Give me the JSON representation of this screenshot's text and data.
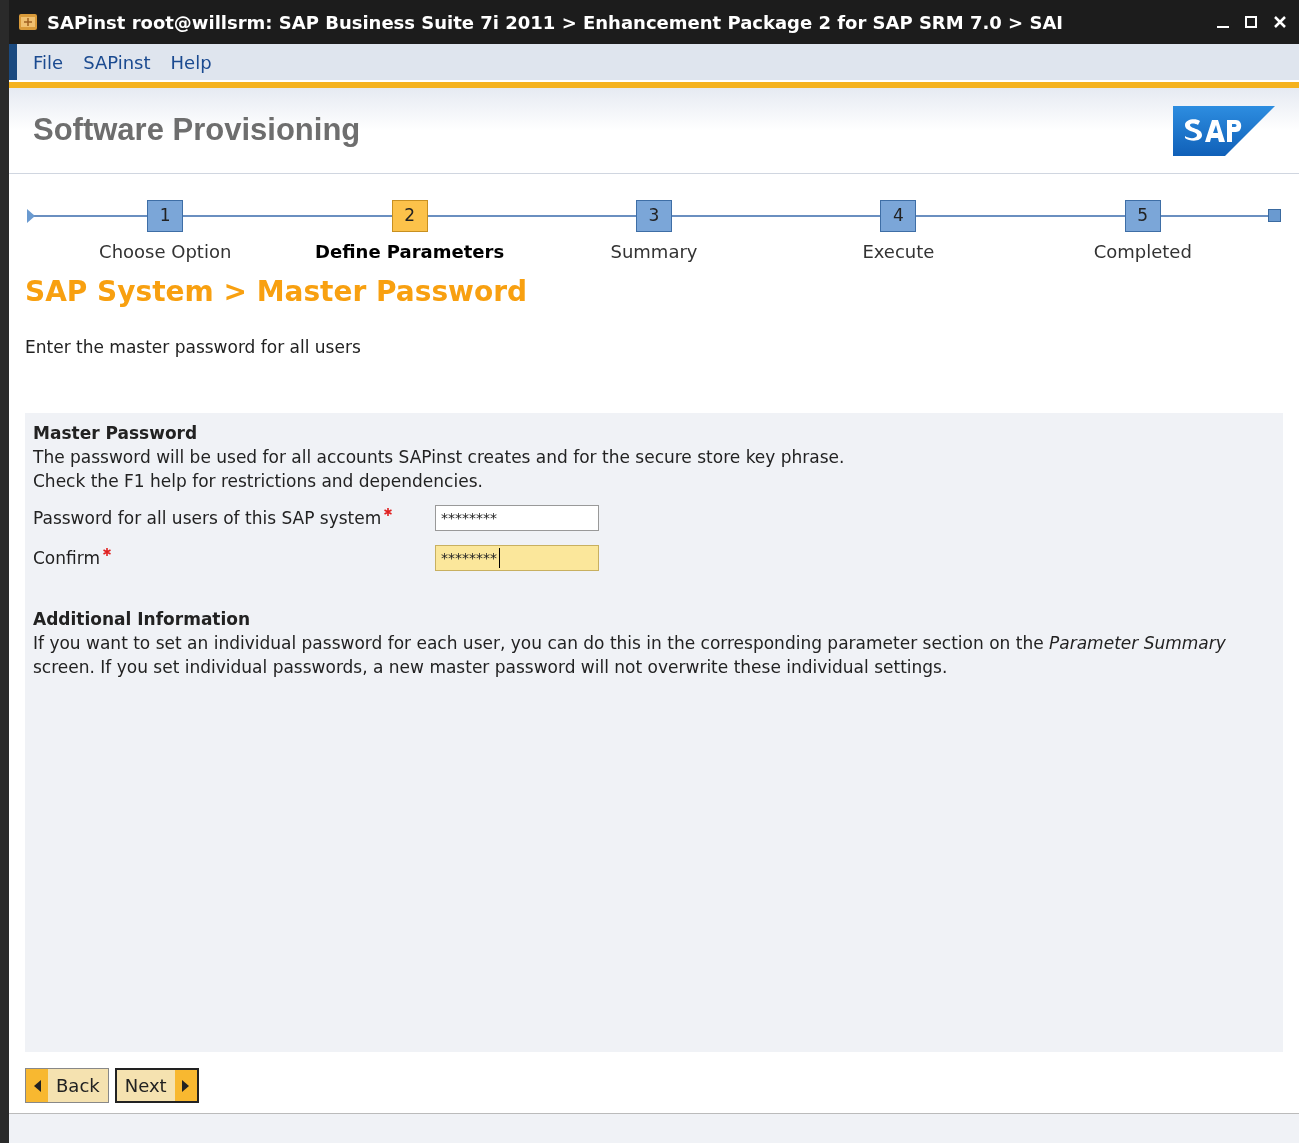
{
  "window": {
    "title": "SAPinst root@willsrm: SAP Business Suite 7i 2011 > Enhancement Package 2 for SAP SRM 7.0 > SAI"
  },
  "menu": [
    "File",
    "SAPinst",
    "Help"
  ],
  "header": {
    "title": "Software Provisioning"
  },
  "steps": [
    {
      "number": "1",
      "label": "Choose Option",
      "selected": false
    },
    {
      "number": "2",
      "label": "Define Parameters",
      "selected": true
    },
    {
      "number": "3",
      "label": "Summary",
      "selected": false
    },
    {
      "number": "4",
      "label": "Execute",
      "selected": false
    },
    {
      "number": "5",
      "label": "Completed",
      "selected": false
    }
  ],
  "page_title": "SAP System > Master Password",
  "intro": "Enter the master password for all users",
  "section": {
    "title": "Master Password",
    "lines": [
      "The password will be used for all accounts SAPinst creates and for the secure store key phrase.",
      "Check the F1 help for restrictions and dependencies."
    ],
    "fields": [
      {
        "label": "Password for all users of this SAP system",
        "required": true,
        "value": "********",
        "focused": false
      },
      {
        "label": "Confirm",
        "required": true,
        "value": "********",
        "focused": true
      }
    ]
  },
  "additional": {
    "title": "Additional Information",
    "text": "If you want to set an individual password for each user, you can do this in the corresponding parameter section on the *Parameter Summary* screen. If you set individual passwords, a new master password will not overwrite these individual settings."
  },
  "buttons": [
    {
      "label": "Back",
      "kind": "back",
      "selected": false
    },
    {
      "label": "Next",
      "kind": "next",
      "selected": true
    }
  ]
}
